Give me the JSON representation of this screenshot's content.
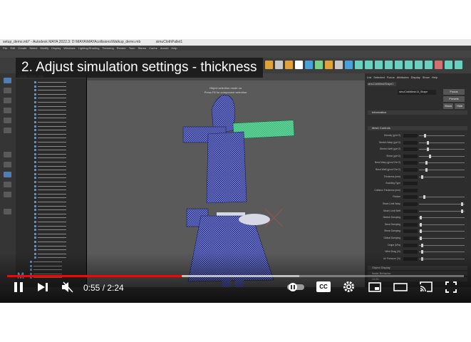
{
  "window": {
    "title": "setup_demo.mb* - Autodesk MAYA 2022.3: D:\\MAYA\\MAYAcollisions\\Walkup_demo.mb",
    "tab_label": "simuClothPallet1"
  },
  "menu": [
    "File",
    "Edit",
    "Create",
    "Select",
    "Modify",
    "Display",
    "Windows",
    "Lighting/Shading",
    "Texturing",
    "Render",
    "Toon",
    "Stereo",
    "Cache",
    "Arnold",
    "Help"
  ],
  "overlay_title": "2. Adjust simulation settings - thickness",
  "viewport_message": {
    "line1": "Object selection mode on.",
    "line2": "Press F8 for component selection."
  },
  "outliner": {
    "menu": [
      "Display",
      "Show",
      "Help"
    ]
  },
  "attribute_editor": {
    "tabs": [
      "List",
      "Selected",
      "Focus",
      "Attributes",
      "Display",
      "Show",
      "Help"
    ],
    "node_label": "simuClothMeshShape1",
    "node_field": "simuClothMesh13_Shape",
    "buttons": [
      "Focus",
      "Presets",
      "Show",
      "Hide"
    ],
    "sections": [
      "Information",
      "Mesh Controls",
      "Object Display",
      "Node Behavior",
      "UUID"
    ],
    "notes": "Notes: simuClothMesh13_Shape",
    "rows": [
      {
        "label": "Density (g/m^2)",
        "knob": 0.12
      },
      {
        "label": "Stretch Warp (g/s^2)",
        "knob": 0.18
      },
      {
        "label": "Stretch Weft (g/s^2)",
        "knob": 0.18
      },
      {
        "label": "Shear (g/s^2)",
        "knob": 0.22
      },
      {
        "label": "Bend Warp (g/cm^2/s^2)",
        "knob": 0.15
      },
      {
        "label": "Bend Weft (g/cm^2/s^2)",
        "knob": 0.15
      },
      {
        "label": "Thickness (mm)",
        "knob": 0.05
      },
      {
        "label": "Buckling Type",
        "knob": -1
      },
      {
        "label": "Collision Thickness (mm)",
        "knob": -1
      },
      {
        "label": "Friction",
        "knob": 0.1
      },
      {
        "label": "Strain Limit Warp",
        "knob": 0.95
      },
      {
        "label": "Strain Limit Weft",
        "knob": 0.95
      },
      {
        "label": "Stretch Damping",
        "knob": 0.02
      },
      {
        "label": "Bend Damping",
        "knob": 0.02
      },
      {
        "label": "Shear Damping",
        "knob": 0.02
      },
      {
        "label": "Global Damping",
        "knob": 0.02
      },
      {
        "label": "Drape (kPa)",
        "knob": 0.05
      },
      {
        "label": "Wind Drag (%)",
        "knob": 0.05
      },
      {
        "label": "Air Pressure (%)",
        "knob": 0.05
      }
    ]
  },
  "player": {
    "time": "0:55 / 2:24",
    "progress": 0.382,
    "buffered": 0.64,
    "controls": [
      "play-icon",
      "next-icon",
      "mute-icon",
      "autoplay-toggle",
      "captions-icon",
      "settings-icon",
      "miniplayer-icon",
      "theater-icon",
      "cast-icon",
      "fullscreen-icon"
    ],
    "cc_label": "CC",
    "accent": "#ff0000"
  },
  "colors": {
    "maya_dark": "#2b2b2b",
    "viewport": "#5a5a5a",
    "mesh": "#1f2a8c",
    "selected_mesh": "#3fbf7f"
  }
}
